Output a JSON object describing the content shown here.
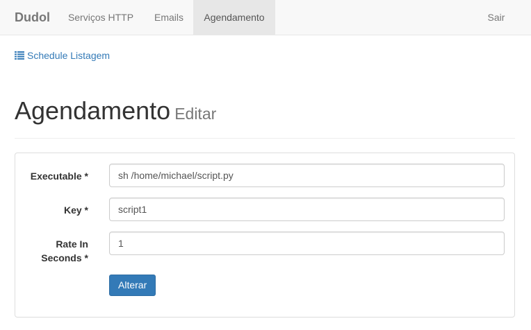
{
  "navbar": {
    "brand": "Dudol",
    "items": [
      {
        "label": "Serviços HTTP",
        "active": false
      },
      {
        "label": "Emails",
        "active": false
      },
      {
        "label": "Agendamento",
        "active": true
      }
    ],
    "logout": "Sair"
  },
  "list_link": {
    "label": "Schedule Listagem",
    "icon": "list-icon"
  },
  "header": {
    "title": "Agendamento",
    "subtitle": "Editar"
  },
  "form": {
    "executable": {
      "label": "Executable *",
      "value": "sh /home/michael/script.py"
    },
    "key": {
      "label": "Key *",
      "value": "script1"
    },
    "rate": {
      "label": "Rate In Seconds *",
      "value": "1"
    },
    "submit_label": "Alterar"
  },
  "colors": {
    "link": "#337ab7",
    "button": "#337ab7",
    "navbar_bg": "#f8f8f8",
    "active_nav_bg": "#e7e7e7"
  }
}
